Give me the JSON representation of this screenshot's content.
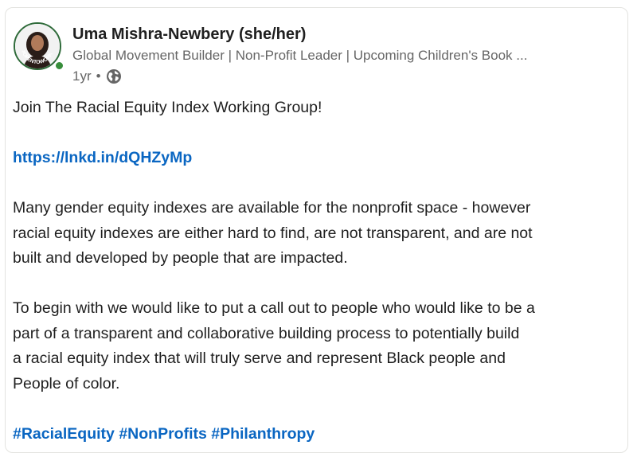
{
  "post": {
    "author": {
      "name": "Uma Mishra-Newbery (she/her)",
      "headline": "Global Movement Builder | Non-Profit Leader | Upcoming Children's Book ...",
      "time": "1yr",
      "separator": "•",
      "visibility_icon": "globe-icon",
      "avatar_badge_text": "#OPENTOWORK",
      "presence_color": "#378d3b"
    },
    "body": {
      "intro": "Join The Racial Equity Index Working Group!",
      "link": "https://lnkd.in/dQHZyMp",
      "paragraph1_lines": [
        "Many gender equity indexes are available for the nonprofit space - however",
        "racial equity indexes are either hard to find, are not transparent, and are not",
        "built and developed by people that are impacted."
      ],
      "paragraph2_lines": [
        "To begin with we would like to put a call out to people who would like to be a",
        "part of a transparent and collaborative building process to potentially build",
        "a racial equity index that will truly serve and represent Black people and",
        "People of color."
      ],
      "hashtags": [
        "#RacialEquity",
        "#NonProfits",
        "#Philanthropy"
      ]
    },
    "colors": {
      "link": "#0a66c2",
      "text": "#1f1f1f",
      "muted": "#666666"
    }
  }
}
